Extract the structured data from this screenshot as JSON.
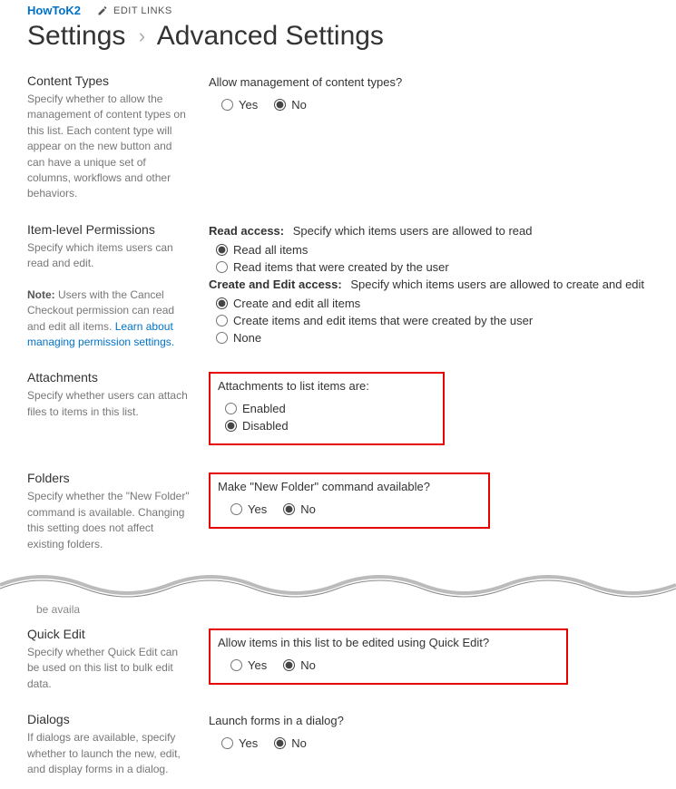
{
  "topbar": {
    "site_name": "HowToK2",
    "edit_links": "EDIT LINKS"
  },
  "breadcrumb": {
    "parent": "Settings",
    "current": "Advanced Settings"
  },
  "sections": {
    "content_types": {
      "title": "Content Types",
      "desc": "Specify whether to allow the management of content types on this list. Each content type will appear on the new button and can have a unique set of columns, workflows and other behaviors.",
      "question": "Allow management of content types?",
      "opt_yes": "Yes",
      "opt_no": "No"
    },
    "item_perm": {
      "title": "Item-level Permissions",
      "desc_1": "Specify which items users can read and edit.",
      "note_label": "Note:",
      "note_text": " Users with the Cancel Checkout permission can read and edit all items. ",
      "note_link": "Learn about managing permission settings.",
      "read_hdr": "Read access:",
      "read_txt": "Specify which items users are allowed to read",
      "read_opt1": "Read all items",
      "read_opt2": "Read items that were created by the user",
      "edit_hdr": "Create and Edit access:",
      "edit_txt": "Specify which items users are allowed to create and edit",
      "edit_opt1": "Create and edit all items",
      "edit_opt2": "Create items and edit items that were created by the user",
      "edit_opt3": "None"
    },
    "attachments": {
      "title": "Attachments",
      "desc": "Specify whether users can attach files to items in this list.",
      "question": "Attachments to list items are:",
      "opt_enabled": "Enabled",
      "opt_disabled": "Disabled"
    },
    "folders": {
      "title": "Folders",
      "desc": "Specify whether the \"New Folder\" command is available. Changing this setting does not affect existing folders.",
      "question": "Make \"New Folder\" command available?",
      "opt_yes": "Yes",
      "opt_no": "No"
    },
    "stub": {
      "left": "be availa"
    },
    "quick_edit": {
      "title": "Quick Edit",
      "desc": "Specify whether Quick Edit can be used on this list to bulk edit data.",
      "question": "Allow items in this list to be edited using Quick Edit?",
      "opt_yes": "Yes",
      "opt_no": "No"
    },
    "dialogs": {
      "title": "Dialogs",
      "desc": "If dialogs are available, specify whether to launch the new, edit, and display forms in a dialog.",
      "question": "Launch forms in a dialog?",
      "opt_yes": "Yes",
      "opt_no": "No"
    }
  }
}
